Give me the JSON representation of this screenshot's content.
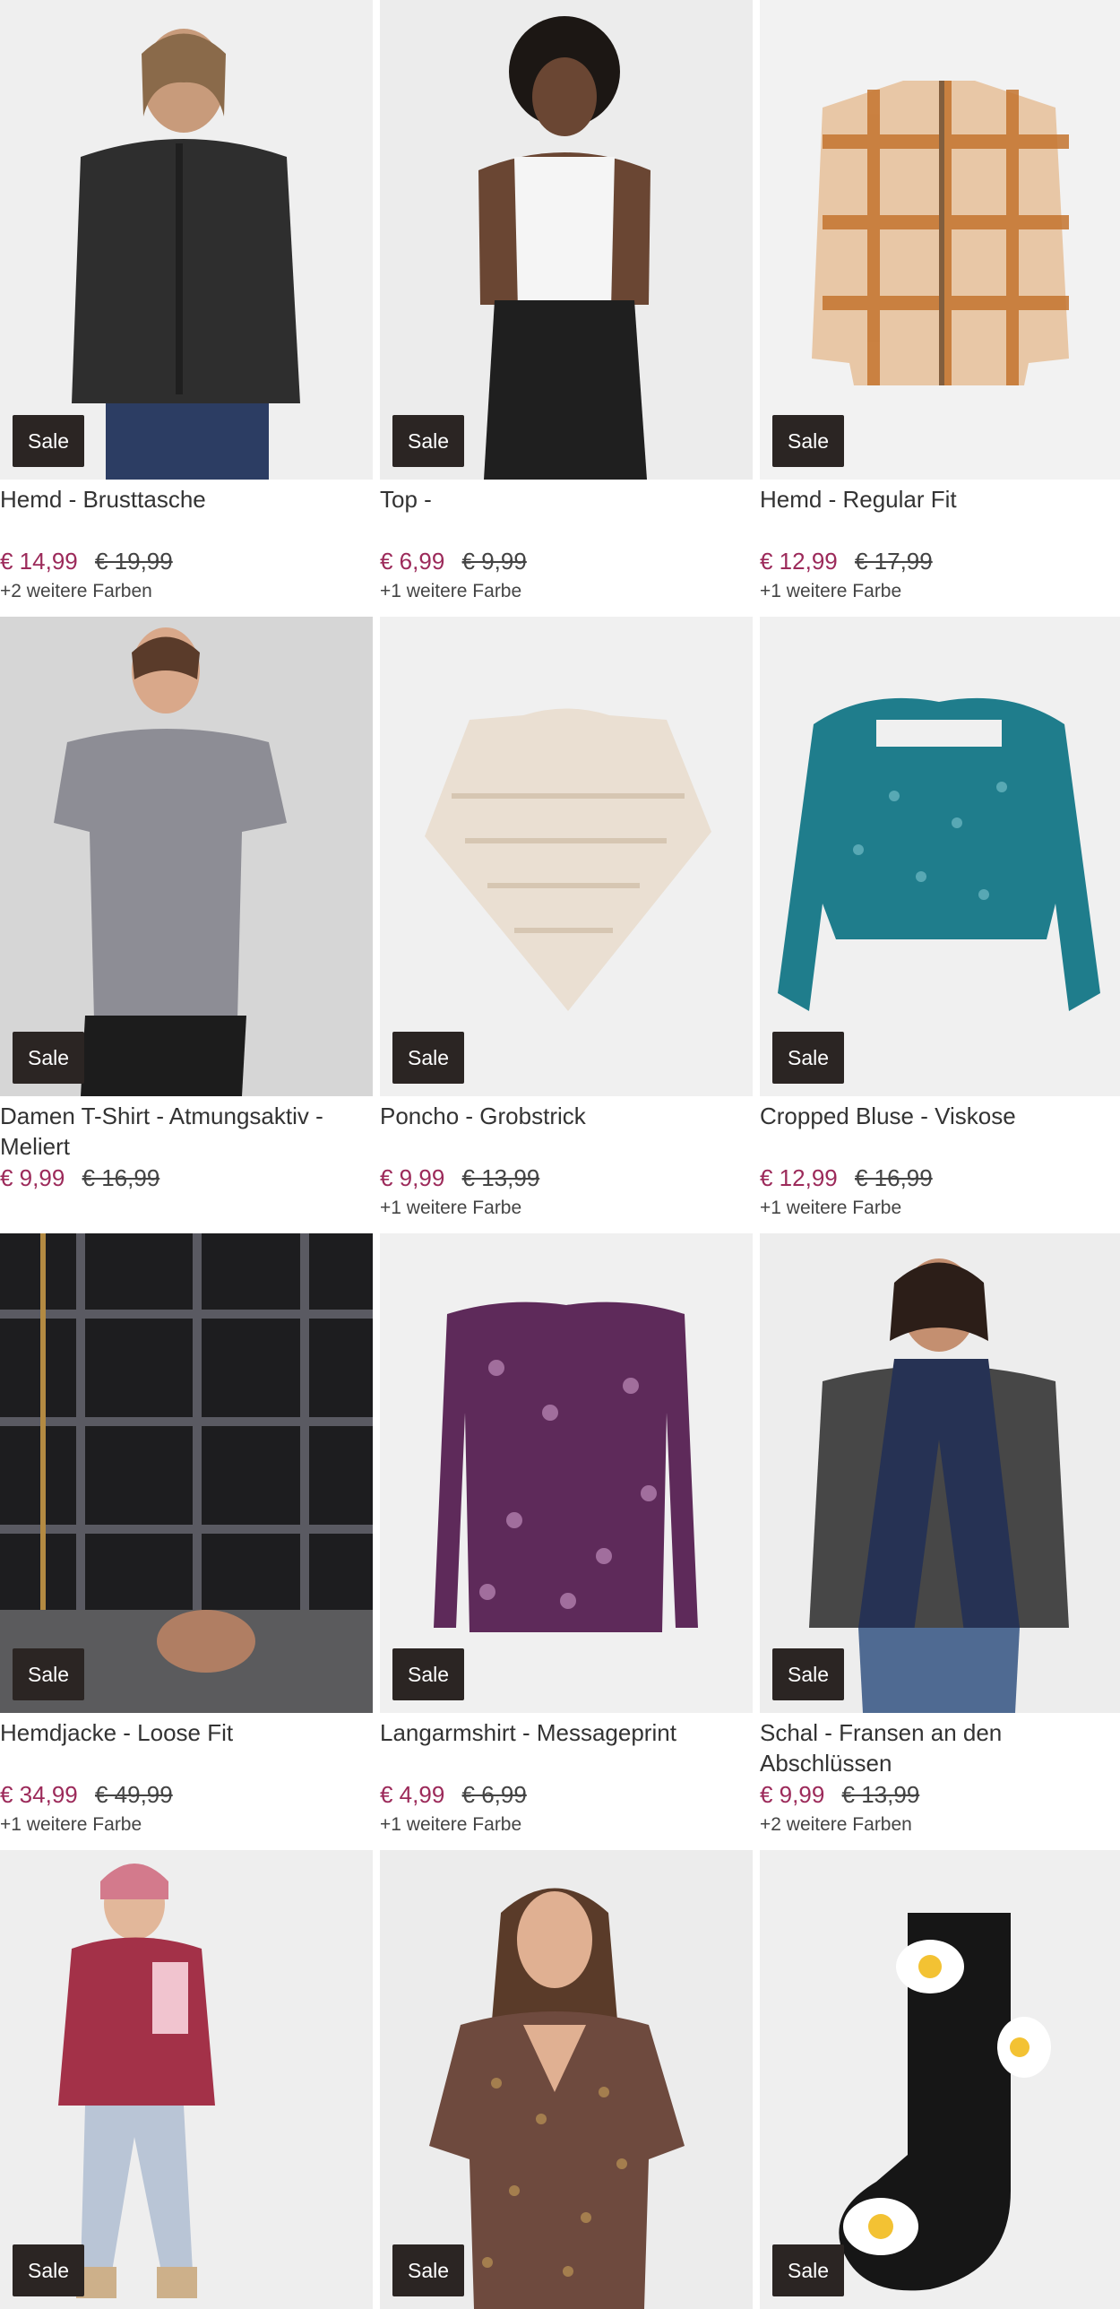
{
  "sale_label": "Sale",
  "colors": {
    "price_sale": "#9c2a5a",
    "badge_bg": "#2b2523"
  },
  "products": [
    {
      "title": "Hemd - Brusttasche",
      "price": "€ 14,99",
      "old_price": "€ 19,99",
      "colors_note": "+2 weitere Farben",
      "image": "man-dark-shirt"
    },
    {
      "title": "Top -",
      "price": "€ 6,99",
      "old_price": "€ 9,99",
      "colors_note": "+1 weitere Farbe",
      "image": "woman-white-top"
    },
    {
      "title": "Hemd - Regular Fit",
      "price": "€ 12,99",
      "old_price": "€ 17,99",
      "colors_note": "+1 weitere Farbe",
      "image": "plaid-shirt-orange"
    },
    {
      "title": "Damen T-Shirt - Atmungsaktiv - Meliert",
      "price": "€ 9,99",
      "old_price": "€ 16,99",
      "colors_note": "",
      "image": "woman-grey-tshirt"
    },
    {
      "title": "Poncho - Grobstrick",
      "price": "€ 9,99",
      "old_price": "€ 13,99",
      "colors_note": "+1 weitere Farbe",
      "image": "knit-poncho"
    },
    {
      "title": "Cropped Bluse - Viskose",
      "price": "€ 12,99",
      "old_price": "€ 16,99",
      "colors_note": "+1 weitere Farbe",
      "image": "teal-blouse"
    },
    {
      "title": "Hemdjacke - Loose Fit",
      "price": "€ 34,99",
      "old_price": "€ 49,99",
      "colors_note": "+1 weitere Farbe",
      "image": "plaid-jacket"
    },
    {
      "title": "Langarmshirt - Messageprint",
      "price": "€ 4,99",
      "old_price": "€ 6,99",
      "colors_note": "+1 weitere Farbe",
      "image": "purple-longsleeve"
    },
    {
      "title": "Schal - Fransen an den Abschlüssen",
      "price": "€ 9,99",
      "old_price": "€ 13,99",
      "colors_note": "+2 weitere Farben",
      "image": "woman-navy-scarf"
    },
    {
      "title": "",
      "price": "",
      "old_price": "",
      "colors_note": "",
      "image": "kid-fleece-jacket"
    },
    {
      "title": "",
      "price": "",
      "old_price": "",
      "colors_note": "",
      "image": "woman-floral-dress"
    },
    {
      "title": "",
      "price": "",
      "old_price": "",
      "colors_note": "",
      "image": "egg-socks"
    }
  ]
}
